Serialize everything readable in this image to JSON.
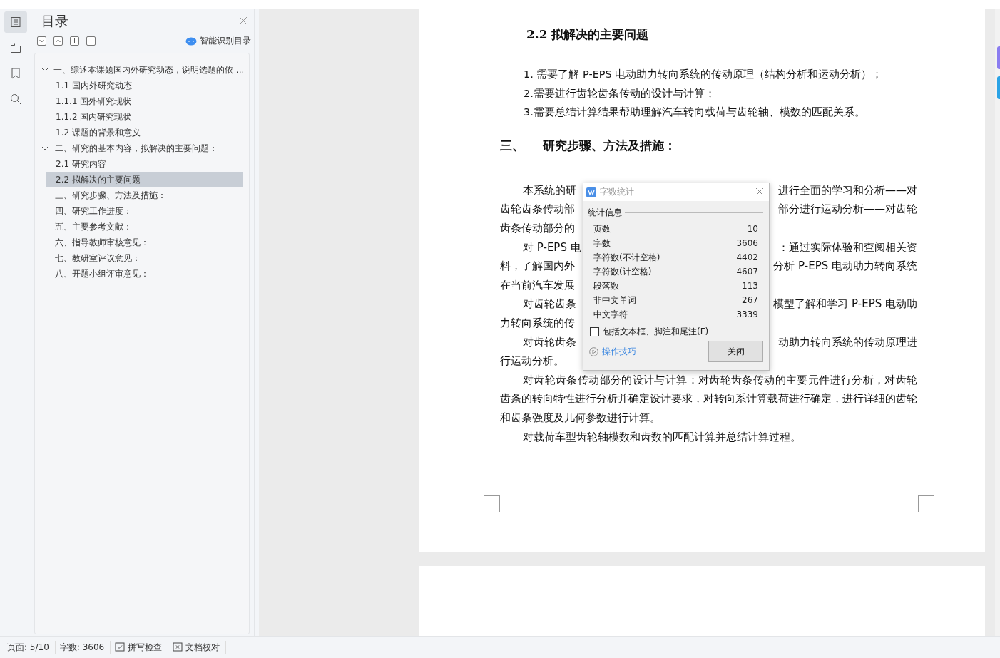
{
  "rail": [
    {
      "kind": "toc",
      "selected": true
    },
    {
      "kind": "outline",
      "selected": false
    },
    {
      "kind": "bookmark",
      "selected": false
    },
    {
      "kind": "search",
      "selected": false
    }
  ],
  "toc": {
    "title": "目录",
    "smart_label": "智能识别目录",
    "items": [
      {
        "label": "一、综述本课题国内外研究动态，说明选题的依 ...",
        "expanded": true,
        "selected": false,
        "children": [
          {
            "label": "1.1 国内外研究动态",
            "selected": false
          },
          {
            "label": "1.1.1 国外研究现状",
            "selected": false
          },
          {
            "label": "1.1.2 国内研究现状",
            "selected": false
          },
          {
            "label": "1.2 课题的背景和意义",
            "selected": false
          }
        ]
      },
      {
        "label": "二、研究的基本内容，拟解决的主要问题：",
        "expanded": true,
        "selected": false,
        "children": [
          {
            "label": "2.1 研究内容",
            "selected": false
          },
          {
            "label": "2.2  拟解决的主要问题",
            "selected": true
          }
        ]
      },
      {
        "label": "三、研究步骤、方法及措施：",
        "selected": false
      },
      {
        "label": "四、研究工作进度：",
        "selected": false
      },
      {
        "label": "五、主要参考文献：",
        "selected": false
      },
      {
        "label": "六、指导教师审核意见：",
        "selected": false
      },
      {
        "label": "七、教研室评议意见：",
        "selected": false
      },
      {
        "label": "八、开题小组评审意见：",
        "selected": false
      }
    ]
  },
  "document": {
    "heading": "2.2  拟解决的主要问题",
    "list": [
      "1. 需要了解  P-EPS 电动助力转向系统的传动原理（结构分析和运动分析）；",
      "2.需要进行齿轮齿条传动的设计与计算；",
      "3.需要总结计算结果帮助理解汽车转向载荷与齿轮轴、模数的匹配关系。"
    ],
    "section_number": "三、",
    "section_title": "研究步骤、方法及措施：",
    "partial_lines": [
      {
        "left": "本系统的研",
        "right": "进行全面的学习和分析——对",
        "indent": true
      },
      {
        "left": "齿轮齿条传动部",
        "right": "部分进行运动分析——对齿轮",
        "indent": false
      },
      {
        "left": "齿条传动部分的",
        "indent": false
      },
      {
        "left": "对 P-EPS 电",
        "right": "：通过实际体验和查阅相关资",
        "indent": true
      },
      {
        "left": "料，了解国内外",
        "right": "分析 P-EPS 电动助力转向系统",
        "indent": false
      },
      {
        "left": "在当前汽车发展",
        "indent": false
      },
      {
        "left": "对齿轮齿条",
        "right": "模型了解和学习 P-EPS 电动助",
        "indent": true
      },
      {
        "left": "力转向系统的传",
        "indent": false
      },
      {
        "left": "对齿轮齿条",
        "right": "动助力转向系统的传动原理进",
        "indent": true
      },
      {
        "left": "行运动分析。",
        "indent": false
      }
    ],
    "paragraphs": [
      "对齿轮齿条传动部分的设计与计算：对齿轮齿条传动的主要元件进行分析，对齿轮齿条的转向特性进行分析并确定设计要求，对转向系计算载荷进行确定，进行详细的齿轮和齿条强度及几何参数进行计算。",
      "对载荷车型齿轮轴模数和齿数的匹配计算并总结计算过程。"
    ]
  },
  "dialog": {
    "title": "字数统计",
    "group": "统计信息",
    "stats": [
      {
        "label": "页数",
        "value": "10"
      },
      {
        "label": "字数",
        "value": "3606"
      },
      {
        "label": "字符数(不计空格)",
        "value": "4402"
      },
      {
        "label": "字符数(计空格)",
        "value": "4607"
      },
      {
        "label": "段落数",
        "value": "113"
      },
      {
        "label": "非中文单词",
        "value": "267"
      },
      {
        "label": "中文字符",
        "value": "3339"
      }
    ],
    "checkbox": {
      "label": "包括文本框、脚注和尾注(F)",
      "checked": false
    },
    "tips_link": "操作技巧",
    "close_button": "关闭"
  },
  "status_bar": [
    {
      "kind": "text",
      "label": "页面: 5/10"
    },
    {
      "kind": "text",
      "label": "字数: 3606"
    },
    {
      "kind": "spell",
      "label": "拼写检查"
    },
    {
      "kind": "proof",
      "label": "文档校对"
    }
  ]
}
